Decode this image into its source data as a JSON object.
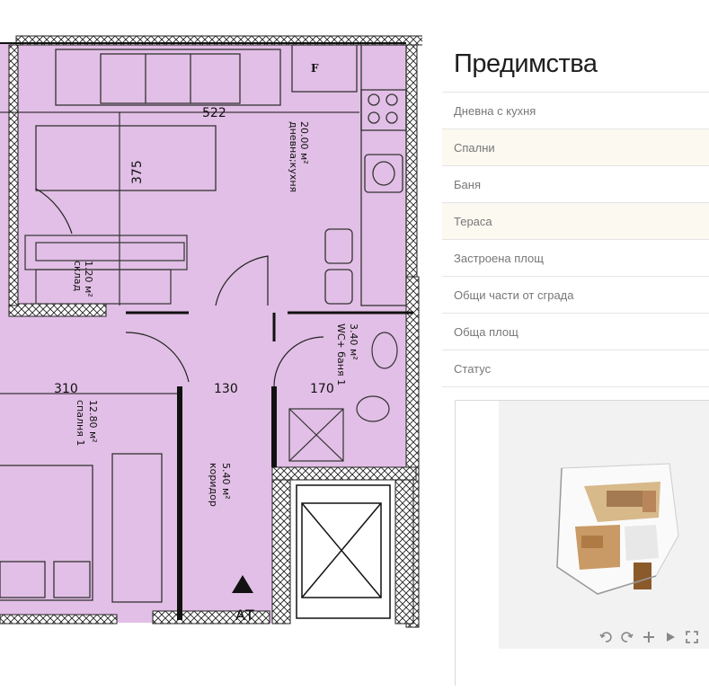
{
  "floorplan": {
    "colors": {
      "room_fill": "#e2bfe6",
      "wall": "#1a1a1a"
    },
    "dimensions": {
      "living_width": "522",
      "living_depth": "375",
      "bedroom_width": "310",
      "corridor_width": "130",
      "bath_width": "170"
    },
    "rooms": {
      "living": {
        "area": "20.00 м²",
        "name": "дневна;кухня"
      },
      "storage": {
        "area": "1.20 м²",
        "name": "склад"
      },
      "bath": {
        "area": "3.40 м²",
        "name": "WC+ баня 1"
      },
      "bedroom": {
        "area": "12.80 м²",
        "name": "спалня 1"
      },
      "corridor": {
        "area": "5.40 м²",
        "name": "коридор"
      }
    },
    "fridge_label": "F",
    "elevator_label": "АТ"
  },
  "panel": {
    "title": "Предимства",
    "rows": [
      "Дневна с кухня",
      "Спални",
      "Баня",
      "Тераса",
      "Застроена площ",
      "Общи части от сграда",
      "Обща площ",
      "Статус"
    ]
  },
  "viewer": {
    "controls": [
      "rotate-left-icon",
      "rotate-right-icon",
      "zoom-in-icon",
      "play-icon",
      "fullscreen-icon"
    ]
  }
}
